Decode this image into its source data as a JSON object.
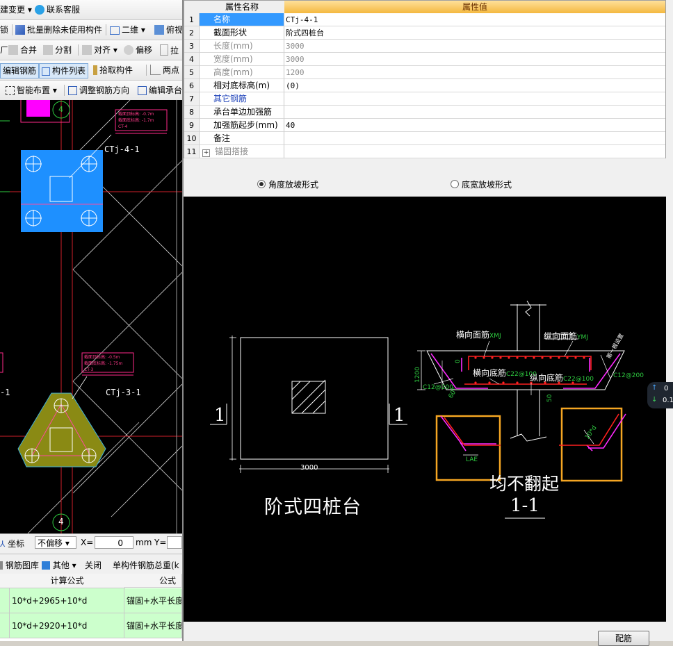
{
  "left": {
    "toolbar_row1": {
      "change": "建变更",
      "support": "联系客服"
    },
    "toolbar_row2": {
      "lock": "锁",
      "batch_delete": "批量删除未使用构件",
      "view2d": "二维",
      "view3d": "俯视"
    },
    "toolbar_row3": {
      "merge": "合并",
      "split": "分割",
      "align": "对齐",
      "offset": "偏移",
      "stretch": "拉"
    },
    "toolbar_row4": {
      "edit_rebar": "编辑钢筋",
      "component_list": "构件列表",
      "pick": "拾取构件",
      "two_point": "两点"
    },
    "toolbar_row5": {
      "smart_layout": "智能布置",
      "adjust_dir": "调整钢筋方向",
      "edit_cap": "编辑承台"
    },
    "canvas": {
      "labels": {
        "ctj4": "CTj-4-1",
        "ctj3": "CTj-3-1",
        "axis_a": "4",
        "axis_b": "4",
        "edge_left": "-1"
      },
      "tags_top": [
        "截面顶标高: -0.7m",
        "截面底标高: -1.7m",
        "CT-4"
      ],
      "tags_mid": [
        "截面顶标高: -0.5m",
        "截面底标高: -1.75m",
        "CT-3"
      ]
    },
    "coord_bar": {
      "coord": "坐标",
      "no_offset": "不偏移",
      "x_label": "X=",
      "x_value": "0",
      "unit": "mm",
      "y_label": "Y="
    },
    "rebar_bar": {
      "rebar_library": "钢筋图库",
      "other": "其他",
      "close": "关闭",
      "total": "单构件钢筋总重(k"
    },
    "formula_table": {
      "headers": [
        "计算公式",
        "公式"
      ],
      "rows": [
        [
          "10*d+2965+10*d",
          "锚固+水平长度"
        ],
        [
          "10*d+2920+10*d",
          "锚固+水平长度"
        ]
      ]
    }
  },
  "props": {
    "header_name": "属性名称",
    "header_value": "属性值",
    "rows": [
      {
        "num": "1",
        "name": "名称",
        "value": "CTj-4-1",
        "style": "normal"
      },
      {
        "num": "2",
        "name": "截面形状",
        "value": "阶式四桩台",
        "style": "normal"
      },
      {
        "num": "3",
        "name": "长度(mm)",
        "value": "3000",
        "style": "gray"
      },
      {
        "num": "4",
        "name": "宽度(mm)",
        "value": "3000",
        "style": "gray"
      },
      {
        "num": "5",
        "name": "高度(mm)",
        "value": "1200",
        "style": "gray"
      },
      {
        "num": "6",
        "name": "相对底标高(m)",
        "value": "(0)",
        "style": "normal"
      },
      {
        "num": "7",
        "name": "其它钢筋",
        "value": "",
        "style": "blue"
      },
      {
        "num": "8",
        "name": "承台单边加强筋",
        "value": "",
        "style": "normal"
      },
      {
        "num": "9",
        "name": "加强筋起步(mm)",
        "value": "40",
        "style": "normal"
      },
      {
        "num": "10",
        "name": "备注",
        "value": "",
        "style": "normal"
      },
      {
        "num": "11",
        "name": "锚固搭接",
        "value": "",
        "style": "expand"
      }
    ]
  },
  "radio": {
    "angle": "角度放坡形式",
    "bottom_width": "底宽放坡形式",
    "selected": "angle"
  },
  "drawing": {
    "plan_title": "阶式四桩台",
    "plan_dim": "3000",
    "section_mark": "1",
    "section_title": "1-1",
    "note": "均不翻起",
    "labels": {
      "h_top": "横向面筋",
      "h_top_code": "XMJ",
      "v_top": "纵向面筋",
      "v_top_code": "YMJ",
      "h_bot": "横向底筋",
      "h_bot_code": "C22@100",
      "v_bot": "纵向底筋",
      "v_bot_code": "C22@100",
      "side_left": "C12@200",
      "side_right": "C12@200",
      "h1200": "1200",
      "zero": "0",
      "angle": "60°",
      "fifty": "50",
      "lae": "LAE",
      "tend": "10*d",
      "slope_note": "第一根设置"
    }
  },
  "ok_button": "配筋",
  "float": {
    "up": "0",
    "down": "0.1"
  }
}
